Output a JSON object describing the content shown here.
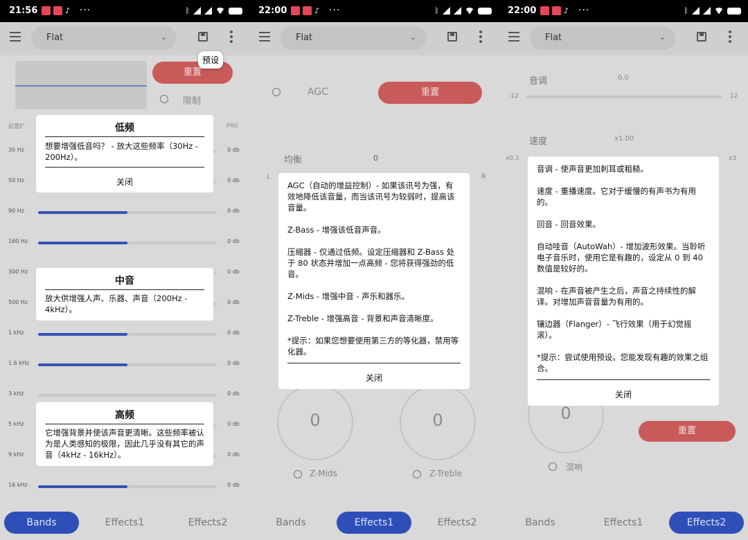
{
  "status_bars": [
    {
      "time": "21:56"
    },
    {
      "time": "22:00"
    },
    {
      "time": "22:00"
    }
  ],
  "status_icons": {
    "notify1": "ü",
    "notify2": "ü",
    "tiktok": "♪",
    "more": "···"
  },
  "appbar": {
    "preset": "Flat"
  },
  "panel1": {
    "tooltip": "预设",
    "reset_label": "重置",
    "limit_label": "限制",
    "pre_amp_label": "前置扩",
    "pro_label": "PRO",
    "bands": [
      {
        "hz": "30 Hz",
        "db": "0 db",
        "fill": 0
      },
      {
        "hz": "50 Hz",
        "db": "0 db",
        "fill": 0
      },
      {
        "hz": "90 Hz",
        "db": "0 db",
        "fill": 0.5
      },
      {
        "hz": "160 Hz",
        "db": "0 db",
        "fill": 0.5
      },
      {
        "hz": "300 Hz",
        "db": "0 db",
        "fill": 0
      },
      {
        "hz": "500 Hz",
        "db": "0 db",
        "fill": 0
      },
      {
        "hz": "1 kHz",
        "db": "0 db",
        "fill": 0.5
      },
      {
        "hz": "1.6 kHz",
        "db": "0 db",
        "fill": 0.5
      },
      {
        "hz": "3 kHz",
        "db": "0 db",
        "fill": 0
      },
      {
        "hz": "5 kHz",
        "db": "0 db",
        "fill": 0
      },
      {
        "hz": "9 kHz",
        "db": "0 db",
        "fill": 0
      },
      {
        "hz": "16 kHz",
        "db": "0 db",
        "fill": 0.5
      }
    ],
    "popup_low": {
      "title": "低频",
      "body": "想要增强低音吗？ - 放大这些频率（30Hz - 200Hz）。",
      "close": "关闭"
    },
    "popup_mid": {
      "title": "中音",
      "body": "放大供增强人声、乐器、声音（200Hz - 4kHz）。"
    },
    "popup_high": {
      "title": "高频",
      "body": "它增强背景并使该声音更清晰。这些频率被认为是人类感知的极限，因此几乎没有其它的声音（4kHz - 16kHz）。"
    }
  },
  "panel2": {
    "agc_label": "AGC",
    "reset_label": "重置",
    "balance_label": "均衡",
    "balance_value": "0",
    "left_label": "L",
    "right_label": "R",
    "popup": {
      "p1": "AGC（自动的增益控制）- 如果该讯号为强，有效地降低该音量，而当该讯号为较弱时，提高该音量。",
      "p2": "Z-Bass - 增强该低音声音。",
      "p3": "压缩器 - 仅通过低频。设定压缩器和 Z-Bass 处于 80 状态并增加一点高频 - 您将获得强劲的低音。",
      "p4": "Z-Mids - 增强中音 - 声乐和器乐。",
      "p5": "Z-Treble - 增强高音 - 背景和声音清晰度。",
      "p6": "*提示：如果您想要使用第三方的等化器，禁用等化器。",
      "close": "关闭"
    },
    "knob_left": "0",
    "knob_right": "0",
    "zmids_label": "Z-Mids",
    "ztreble_label": "Z-Treble"
  },
  "panel3": {
    "pitch_label": "音调",
    "pitch_value": "0.0",
    "pitch_min": "-12",
    "pitch_max": "12",
    "speed_label": "速度",
    "speed_value": "x1.00",
    "speed_min": "x0.3",
    "speed_max": "x3",
    "popup": {
      "p1": "音调 - 使声音更加刺耳或粗糙。",
      "p2": "速度 - 重播速度。它对于缓慢的有声书为有用的。",
      "p3": "回音 - 回音效果。",
      "p4": "自动哇音（AutoWah）- 增加波形效果。当聆听电子音乐时，使用它是有趣的，设定从 0 到 40 数值是较好的。",
      "p5": "混响 - 在声音被产生之后，声音之持续性的解译。对增加声音音量为有用的。",
      "p6": "镶边器（Flanger）- 飞行效果（用于幻觉摇滚）。",
      "p7": "*提示：尝试使用预设。您能发现有趣的效果之组合。",
      "close": "关闭"
    },
    "knob_value": "0",
    "reset_label": "重置",
    "reverb_label": "混响"
  },
  "tabs": [
    "Bands",
    "Effects1",
    "Effects2"
  ],
  "colors": {
    "accent": "#2f4fb8",
    "reset": "#c95a5a"
  }
}
